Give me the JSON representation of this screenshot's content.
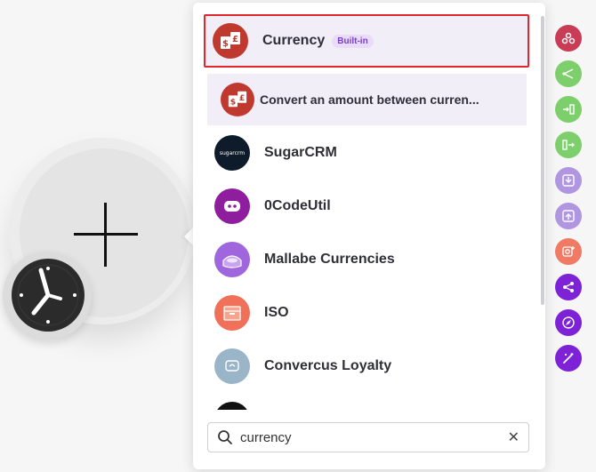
{
  "search": {
    "value": "currency",
    "clear_label": "✕"
  },
  "selected_app": {
    "name": "Currency",
    "badge": "Built-in",
    "module_description": "Convert an amount between curren...",
    "color": "#c0392f"
  },
  "apps": [
    {
      "name": "SugarCRM",
      "logo_text": "sugarcrm",
      "color": "#0e1b2a"
    },
    {
      "name": "0CodeUtil",
      "color": "#8e1e9e"
    },
    {
      "name": "Mallabe Currencies",
      "color": "#9f66dd"
    },
    {
      "name": "ISO",
      "color": "#f0705a"
    },
    {
      "name": "Convercus Loyalty",
      "color": "#9ab4c8"
    }
  ],
  "rail": [
    {
      "icon": "webhook-icon",
      "color": "#c93c55"
    },
    {
      "icon": "router-icon",
      "color": "#7ccf6a"
    },
    {
      "icon": "iterator-icon",
      "color": "#7ccf6a"
    },
    {
      "icon": "aggregator-icon",
      "color": "#7ccf6a"
    },
    {
      "icon": "download-icon",
      "color": "#b095e0"
    },
    {
      "icon": "upload-icon",
      "color": "#b095e0"
    },
    {
      "icon": "search-add-icon",
      "color": "#f07a63"
    },
    {
      "icon": "share-icon",
      "color": "#7d22d6"
    },
    {
      "icon": "compass-icon",
      "color": "#7d22d6"
    },
    {
      "icon": "magic-wand-icon",
      "color": "#7d22d6"
    }
  ]
}
